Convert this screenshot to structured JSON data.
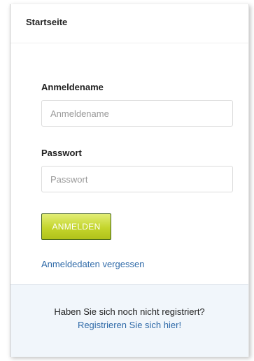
{
  "header": {
    "title": "Startseite"
  },
  "login_form": {
    "username_label": "Anmeldename",
    "username_placeholder": "Anmeldename",
    "username_value": "",
    "password_label": "Passwort",
    "password_placeholder": "Passwort",
    "password_value": "",
    "submit_label": "ANMELDEN",
    "forgot_link": "Anmeldedaten vergessen"
  },
  "register": {
    "prompt": "Haben Sie sich noch nicht registriert?",
    "link": "Registrieren Sie sich hier!"
  },
  "colors": {
    "button_gradient_top": "#e2ee76",
    "button_gradient_bottom": "#b0c21a",
    "link": "#2f6aa8",
    "register_background": "#f1f6fb"
  }
}
